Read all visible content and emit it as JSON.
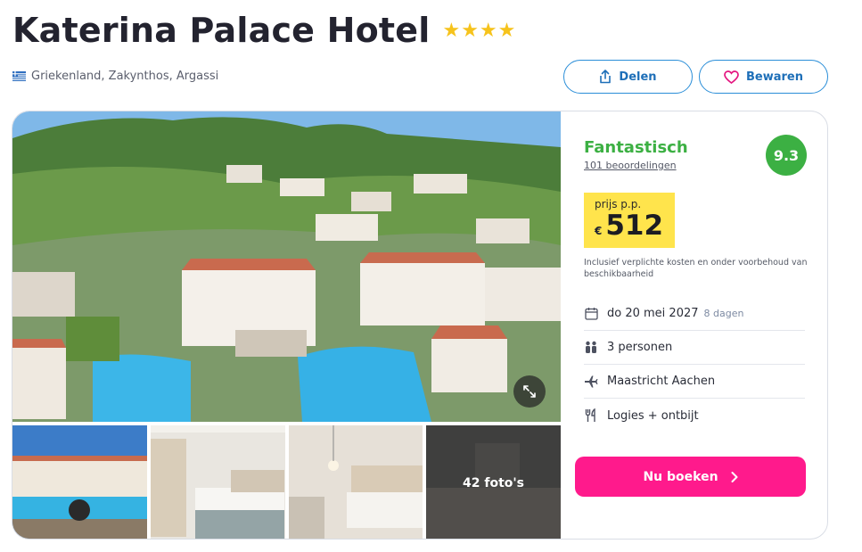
{
  "hotel": {
    "name": "Katerina Palace Hotel",
    "stars": "★★★★",
    "location": "Griekenland, Zakynthos, Argassi"
  },
  "actions": {
    "share_label": "Delen",
    "save_label": "Bewaren"
  },
  "gallery": {
    "more_photos_label": "42 foto's"
  },
  "rating": {
    "label": "Fantastisch",
    "reviews": "101 beoordelingen",
    "score": "9.3"
  },
  "price": {
    "label": "prijs p.p.",
    "currency": "€",
    "amount": "512",
    "note": "Inclusief verplichte kosten en onder voorbehoud van beschikbaarheid"
  },
  "details": {
    "date": "do 20 mei 2027",
    "duration": "8 dagen",
    "persons": "3 personen",
    "departure": "Maastricht Aachen",
    "board": "Logies + ontbijt"
  },
  "booking": {
    "button_label": "Nu boeken"
  },
  "colors": {
    "accent_blue": "#2a8ed8",
    "rating_green": "#3cb043",
    "price_yellow": "#ffe44c",
    "book_pink": "#ff1a8c",
    "stars": "#f6c31c"
  },
  "icons": [
    "greece-flag-icon",
    "share-icon",
    "heart-icon",
    "expand-icon",
    "calendar-icon",
    "persons-icon",
    "plane-icon",
    "cutlery-icon",
    "chevron-right-icon"
  ]
}
